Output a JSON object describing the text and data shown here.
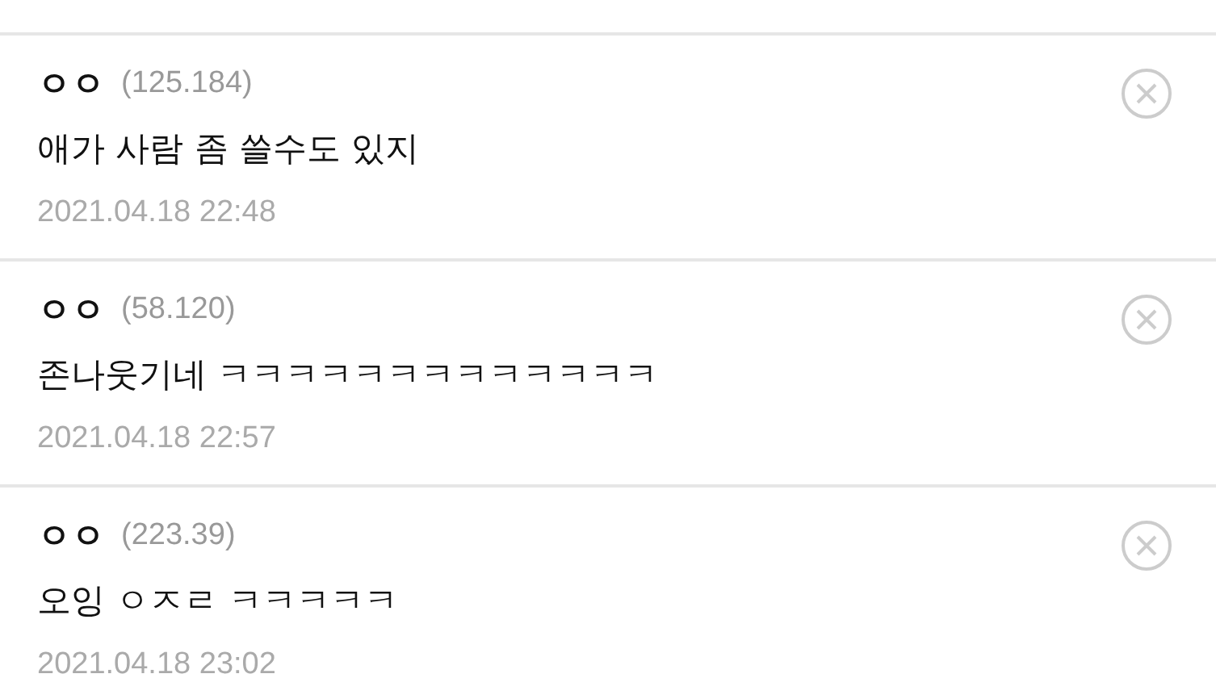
{
  "comments": [
    {
      "author": "ㅇㅇ",
      "ip": "(125.184)",
      "text": "애가 사람 좀 쓸수도 있지",
      "date": "2021.04.18 22:48"
    },
    {
      "author": "ㅇㅇ",
      "ip": "(58.120)",
      "text": "존나웃기네 ㅋㅋㅋㅋㅋㅋㅋㅋㅋㅋㅋㅋㅋ",
      "date": "2021.04.18 22:57"
    },
    {
      "author": "ㅇㅇ",
      "ip": "(223.39)",
      "text": "오잉 ㅇㅈㄹ ㅋㅋㅋㅋㅋ",
      "date": "2021.04.18 23:02"
    }
  ]
}
